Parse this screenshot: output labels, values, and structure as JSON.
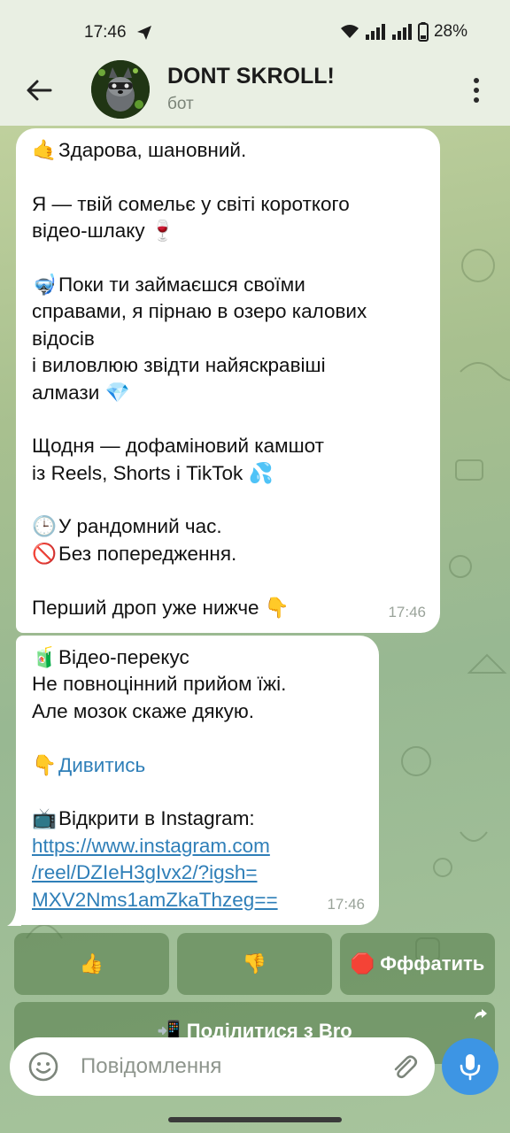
{
  "status_bar": {
    "time": "17:46",
    "battery": "28%"
  },
  "header": {
    "title": "DONT SKROLL!",
    "subtitle": "бот"
  },
  "messages": [
    {
      "lines": [
        {
          "emoji": "🤙",
          "text": "Здарова, шановний."
        },
        {
          "emoji": "",
          "text": ""
        },
        {
          "emoji": "",
          "text": "Я — твій сомельє у світі короткого"
        },
        {
          "emoji": "",
          "text": "відео-шлаку 🍷"
        },
        {
          "emoji": "",
          "text": ""
        },
        {
          "emoji": "🤿",
          "text": "Поки ти займаєшся своїми"
        },
        {
          "emoji": "",
          "text": "справами, я пірнаю в озеро калових"
        },
        {
          "emoji": "",
          "text": "відосів"
        },
        {
          "emoji": "",
          "text": "і виловлюю звідти найяскравіші"
        },
        {
          "emoji": "",
          "text": "алмази 💎"
        },
        {
          "emoji": "",
          "text": ""
        },
        {
          "emoji": "",
          "text": "Щодня — дофаміновий камшот"
        },
        {
          "emoji": "",
          "text": "із Reels, Shorts і TikTok 💦"
        },
        {
          "emoji": "",
          "text": ""
        },
        {
          "emoji": "🕒",
          "text": "У рандомний час."
        },
        {
          "emoji": "🚫",
          "text": "Без попередження."
        },
        {
          "emoji": "",
          "text": ""
        },
        {
          "emoji": "",
          "text": "Перший дроп уже нижче 👇"
        }
      ],
      "time": "17:46"
    },
    {
      "line1_emoji": "🧃",
      "line1": "Відео-перекус",
      "line2": "Не повноцінний прийом їжі.",
      "line3": "Але мозок скаже дякую.",
      "watch_emoji": "👇",
      "watch_link": "Дивитись",
      "open_emoji": "📺",
      "open_text": "Відкрити в Instagram:",
      "url_line1": "https://www.instagram.com",
      "url_line2": "/reel/DZIeH3gIvx2/?igsh=",
      "url_line3": "MXV2Nms1amZkaThzeg==",
      "time": "17:46"
    }
  ],
  "keyboard": {
    "like": "👍",
    "dislike": "👎",
    "stop": "🛑 Фффатить",
    "share": "📲 Поділитися з Bro"
  },
  "composer": {
    "placeholder": "Повідомлення"
  },
  "icons": {
    "status": [
      "send-icon",
      "wifi-icon",
      "signal-icon",
      "battery-icon"
    ],
    "header": [
      "back-arrow-icon",
      "more-vert-icon"
    ],
    "composer": [
      "emoji-smile-icon",
      "paperclip-icon",
      "microphone-icon"
    ]
  },
  "colors": {
    "header_bg": "#e9efe3",
    "bubble_bg": "#ffffff",
    "link": "#2f7fb8",
    "mic_button": "#3d95e4"
  }
}
